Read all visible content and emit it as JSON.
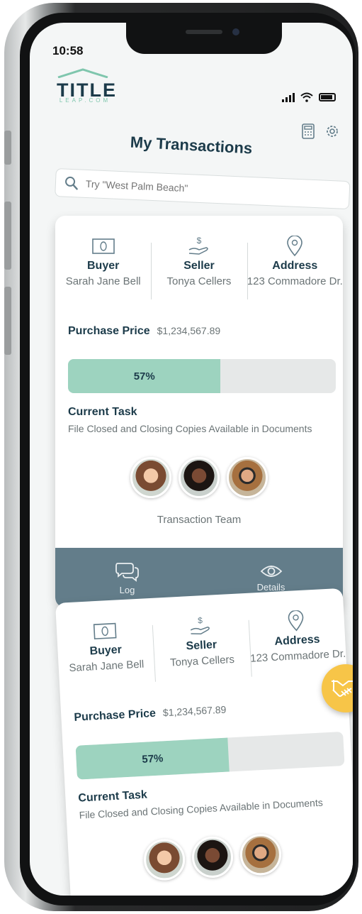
{
  "status": {
    "time": "10:58"
  },
  "brand": {
    "logo_word": "TITLE",
    "logo_sub": "LEAP.COM"
  },
  "page": {
    "title": "My Transactions"
  },
  "search": {
    "placeholder": "Try \"West Palm Beach\""
  },
  "icons": {
    "calculator": "calculator-icon",
    "settings": "gear-icon",
    "search": "search-icon",
    "buyer": "money-bill-icon",
    "seller": "dollar-hand-icon",
    "address": "map-pin-icon",
    "log": "chat-bubbles-icon",
    "details": "eye-icon",
    "fab": "handshake-icon"
  },
  "colors": {
    "primary": "#1c3b4a",
    "accent": "#9dd3bf",
    "action_bar": "#637d8a",
    "fab": "#f7c548"
  },
  "transactions": [
    {
      "buyer_label": "Buyer",
      "buyer_value": "Sarah Jane Bell",
      "seller_label": "Seller",
      "seller_value": "Tonya Cellers",
      "address_label": "Address",
      "address_value": "123 Commadore Dr.",
      "price_label": "Purchase Price",
      "price_value": "$1,234,567.89",
      "progress_label": "57%",
      "progress_value": 57,
      "task_label": "Current Task",
      "task_value": "File Closed and Closing Copies Available in Documents",
      "team_label": "Transaction Team",
      "log_label": "Log",
      "details_label": "Details"
    },
    {
      "buyer_label": "Buyer",
      "buyer_value": "Sarah Jane Bell",
      "seller_label": "Seller",
      "seller_value": "Tonya Cellers",
      "address_label": "Address",
      "address_value": "123 Commadore Dr.",
      "price_label": "Purchase Price",
      "price_value": "$1,234,567.89",
      "progress_label": "57%",
      "progress_value": 57,
      "task_label": "Current Task",
      "task_value": "File Closed and Closing Copies Available in Documents"
    }
  ]
}
